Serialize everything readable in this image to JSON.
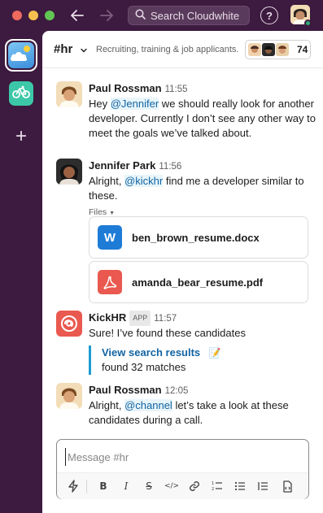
{
  "titlebar": {
    "search_placeholder": "Search Cloudwhite",
    "help_symbol": "?"
  },
  "rail": {
    "add_symbol": "+"
  },
  "channel": {
    "name": "#hr",
    "topic": "Recruiting, training & job applicants.",
    "member_count": "74"
  },
  "messages": [
    {
      "author": "Paul Rossman",
      "time": "11:55",
      "text_before": "Hey ",
      "mention": "@Jennifer",
      "text_after": " we should really look for another developer. Currently I don’t see any other way to meet the goals we’ve talked about."
    },
    {
      "author": "Jennifer Park",
      "time": "11:56",
      "text_before": "Alright, ",
      "mention": "@kickhr",
      "text_after": " find me a developer similar to these.",
      "files_label": "Files",
      "files": [
        {
          "name": "ben_brown_resume.docx",
          "icon": "word-doc-icon",
          "icon_letter": "W",
          "color": "#1e7cd6"
        },
        {
          "name": "amanda_bear_resume.pdf",
          "icon": "pdf-icon",
          "color": "#e9594f"
        }
      ]
    },
    {
      "author": "KickHR",
      "badge": "APP",
      "time": "11:57",
      "text": "Sure! I’ve found these candidates",
      "attachment": {
        "link": "View search results",
        "emoji": "📝",
        "sub": "found 32 matches"
      }
    },
    {
      "author": "Paul Rossman",
      "time": "12:05",
      "text_before": "Alright, ",
      "mention": "@channel",
      "text_after": " let’s take a look at these candidates during a call."
    }
  ],
  "composer": {
    "placeholder": "Message #hr",
    "tools": [
      "lightning-icon",
      "bold-icon",
      "italic-icon",
      "strikethrough-icon",
      "code-icon",
      "link-icon",
      "ordered-list-icon",
      "bulleted-list-icon",
      "blockquote-icon",
      "code-block-icon"
    ],
    "labels": {
      "bold": "B",
      "italic": "I",
      "strike": "S",
      "code": "</>"
    }
  },
  "colors": {
    "sidebar": "#3d1a3f",
    "link": "#1264a3",
    "attachment_bar": "#1d9bd1",
    "kickhr": "#e9594f",
    "presence": "#2bac76"
  }
}
